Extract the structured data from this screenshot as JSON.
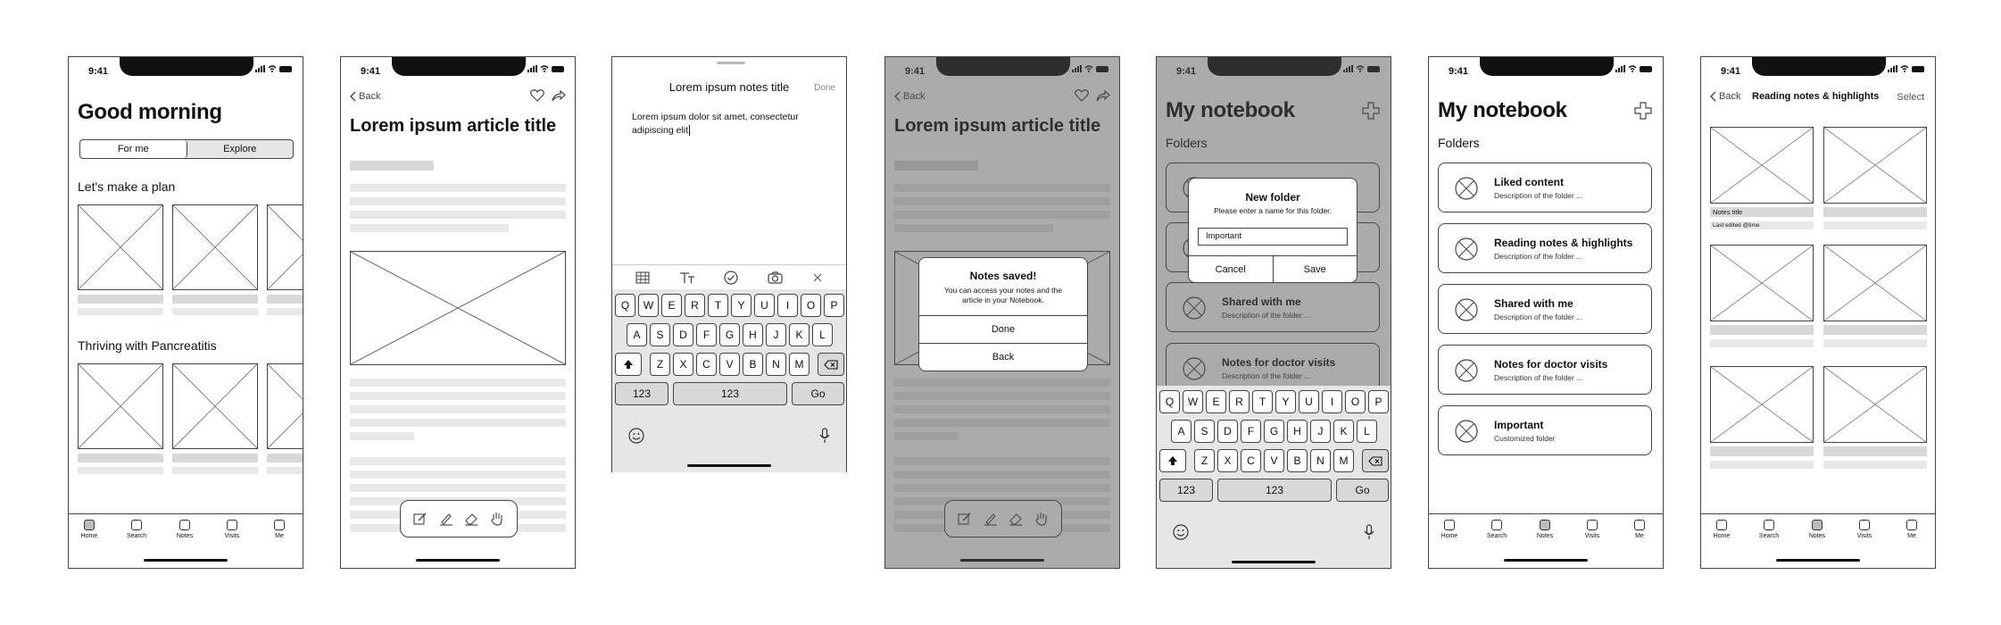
{
  "status_time": "9:41",
  "screen1": {
    "title": "Good morning",
    "segment": [
      "For me",
      "Explore"
    ],
    "section1": "Let's make a plan",
    "section2": "Thriving with Pancreatitis"
  },
  "nav": [
    "Home",
    "Search",
    "Notes",
    "Visits",
    "Me"
  ],
  "article": {
    "back": "Back",
    "title": "Lorem ipsum article title"
  },
  "note_editor": {
    "title": "Lorem ipsum notes title",
    "done": "Done",
    "body": "Lorem ipsum dolor sit amet, consectetur adipiscing elit"
  },
  "keyboard": {
    "row1": [
      "Q",
      "W",
      "E",
      "R",
      "T",
      "Y",
      "U",
      "I",
      "O",
      "P"
    ],
    "row2": [
      "A",
      "S",
      "D",
      "F",
      "G",
      "H",
      "J",
      "K",
      "L"
    ],
    "row3": [
      "Z",
      "X",
      "C",
      "V",
      "B",
      "N",
      "M"
    ],
    "num_key": "123",
    "space_key": "123",
    "go_key": "Go"
  },
  "saved_dialog": {
    "title": "Notes saved!",
    "message": "You can access your notes and the article in your Notebook.",
    "done": "Done",
    "back": "Back"
  },
  "notebook": {
    "title": "My notebook",
    "folders_label": "Folders",
    "folders": [
      {
        "name": "Liked content",
        "desc": "Description of the folder ..."
      },
      {
        "name": "Reading notes & highlights",
        "desc": "Description of the folder ..."
      },
      {
        "name": "Shared with me",
        "desc": "Description of the folder ..."
      },
      {
        "name": "Notes for doctor visits",
        "desc": "Description of the folder ..."
      },
      {
        "name": "Important",
        "desc": "Customized folder"
      }
    ]
  },
  "new_folder_dialog": {
    "title": "New folder",
    "message": "Please enter a name for this folder.",
    "input_value": "Important",
    "cancel": "Cancel",
    "save": "Save"
  },
  "reading_notes": {
    "back": "Back",
    "title": "Reading notes & highlights",
    "select": "Select",
    "note_title": "Notes title",
    "last_edited": "Last edited @time"
  }
}
